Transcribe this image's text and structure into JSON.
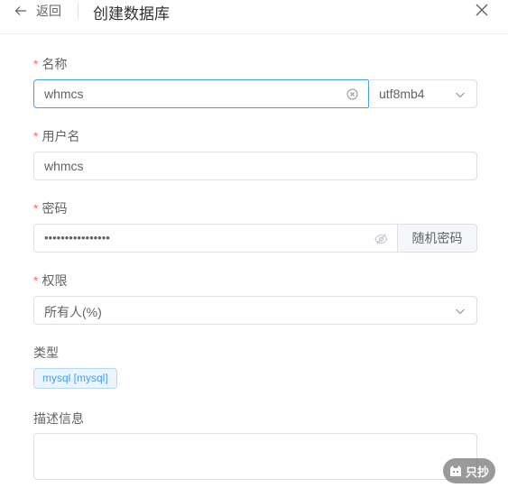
{
  "header": {
    "back_label": "返回",
    "title": "创建数据库"
  },
  "form": {
    "name": {
      "required": "*",
      "label": "名称",
      "value": "whmcs",
      "charset": "utf8mb4"
    },
    "username": {
      "required": "*",
      "label": "用户名",
      "value": "whmcs"
    },
    "password": {
      "required": "*",
      "label": "密码",
      "masked_value": "••••••••••••••••",
      "random_button": "随机密码"
    },
    "permission": {
      "required": "*",
      "label": "权限",
      "value": "所有人(%)"
    },
    "type": {
      "label": "类型",
      "tag": "mysql [mysql]"
    },
    "description": {
      "label": "描述信息",
      "value": ""
    }
  },
  "watermark": {
    "text": "只抄"
  },
  "colors": {
    "accent": "#409eff",
    "required": "#f56c6c",
    "border": "#dcdfe6",
    "tag_bg": "#ecf5ff"
  }
}
